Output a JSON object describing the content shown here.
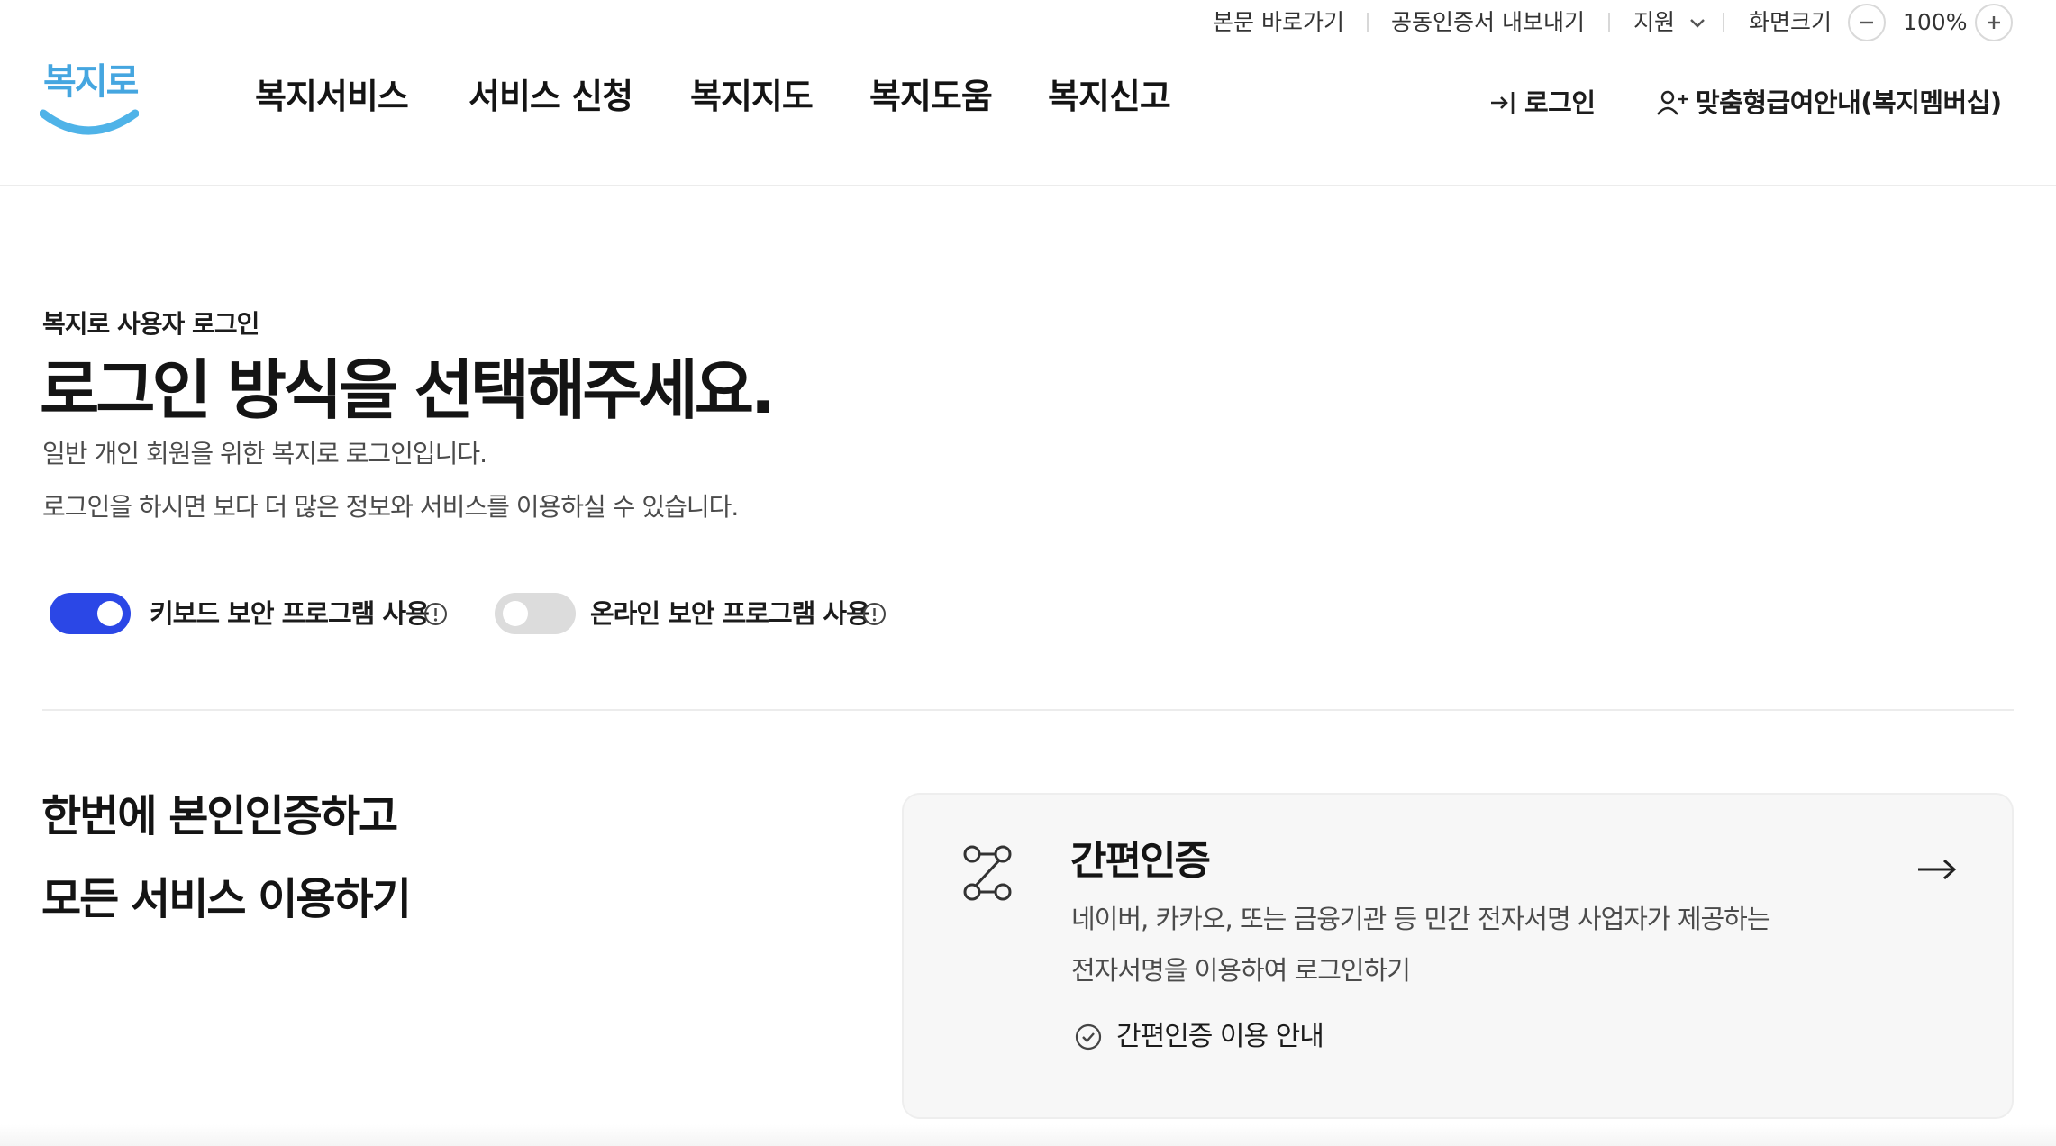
{
  "utility": {
    "skip_link": "본문 바로가기",
    "cert_export": "공동인증서 내보내기",
    "support": "지원",
    "screen_size": "화면크기",
    "zoom": "100%"
  },
  "header": {
    "logo_text": "복지로",
    "nav": [
      "복지서비스",
      "서비스 신청",
      "복지지도",
      "복지도움",
      "복지신고"
    ],
    "login": "로그인",
    "membership": "맞춤형급여안내(복지멤버십)"
  },
  "intro": {
    "eyebrow": "복지로 사용자 로그인",
    "title": "로그인 방식을 선택해주세요.",
    "desc1": "일반 개인 회원을 위한 복지로 로그인입니다.",
    "desc2": "로그인을 하시면 보다 더 많은 정보와 서비스를 이용하실 수 있습니다."
  },
  "security": {
    "keyboard": {
      "label": "키보드 보안 프로그램 사용",
      "enabled": true
    },
    "online": {
      "label": "온라인 보안 프로그램 사용",
      "enabled": false
    }
  },
  "promo": {
    "line1": "한번에 본인인증하고",
    "line2": "모든 서비스 이용하기"
  },
  "cert_card": {
    "title": "간편인증",
    "desc1": "네이버, 카카오, 또는 금융기관 등 민간 전자서명 사업자가 제공하는",
    "desc2": "전자서명을 이용하여 로그인하기",
    "guide": "간편인증 이용 안내"
  },
  "colors": {
    "accent": "#2b47e6",
    "toggle_off": "#dcdcdc",
    "logo_blue": "#45a6e0",
    "logo_smile": "#4fb3e8"
  }
}
